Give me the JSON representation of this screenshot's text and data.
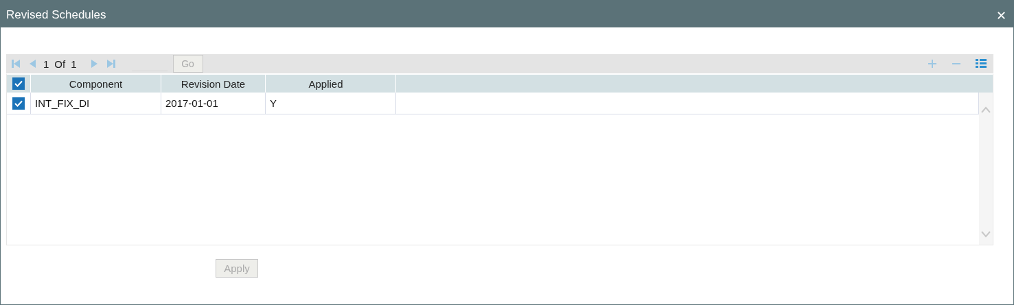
{
  "window": {
    "title": "Revised Schedules",
    "close": "✕"
  },
  "pager": {
    "page": "1",
    "of": "Of",
    "total": "1",
    "go": {
      "label": "Go",
      "disabled": true
    }
  },
  "table": {
    "all_checked": true,
    "columns": [
      "Component",
      "Revision Date",
      "Applied"
    ],
    "rows": [
      {
        "checked": true,
        "cells": [
          "INT_FIX_DI",
          "2017-01-01",
          "Y"
        ]
      }
    ]
  },
  "apply": {
    "label": "Apply",
    "disabled": true
  }
}
